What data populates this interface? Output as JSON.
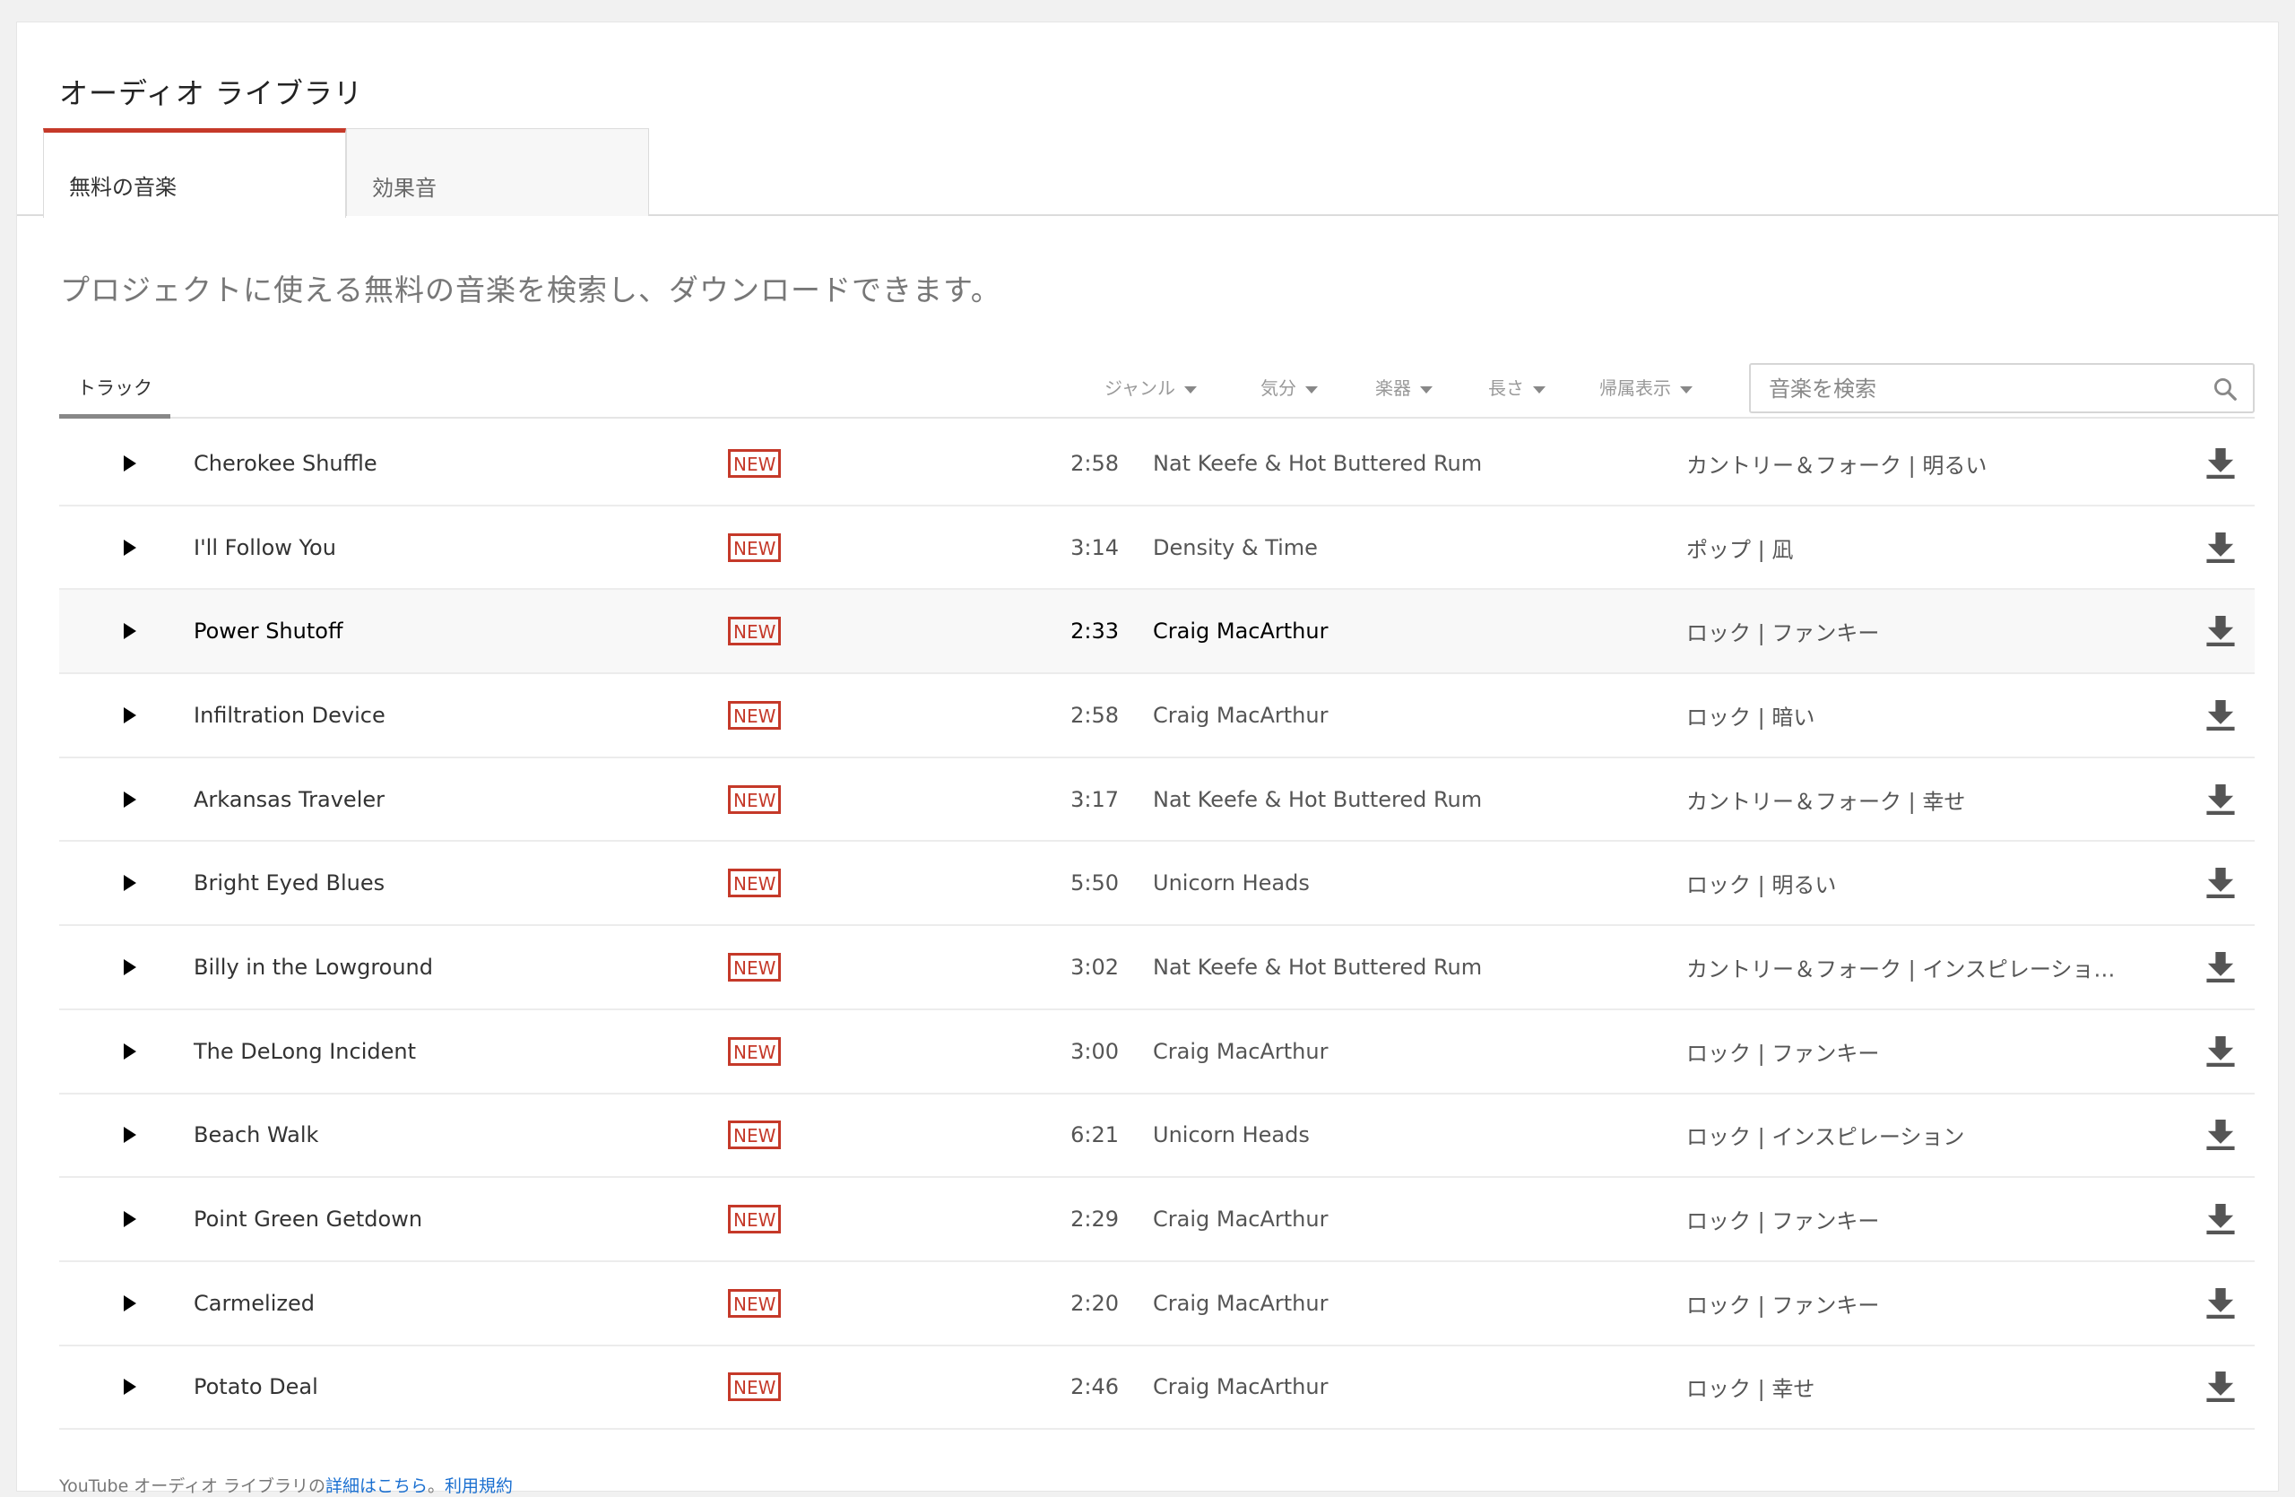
{
  "page_title": "オーディオ ライブラリ",
  "tabs": [
    {
      "label": "無料の音楽",
      "active": true
    },
    {
      "label": "効果音",
      "active": false
    }
  ],
  "subtitle": "プロジェクトに使える無料の音楽を検索し、ダウンロードできます。",
  "filterbar": {
    "tracks_tab": "トラック",
    "filters": [
      "ジャンル",
      "気分",
      "楽器",
      "長さ",
      "帰属表示"
    ],
    "search_placeholder": "音楽を検索"
  },
  "badge_label": "NEW",
  "tracks": [
    {
      "title": "Cherokee Shuffle",
      "duration": "2:58",
      "artist": "Nat Keefe & Hot Buttered Rum",
      "genre": "カントリー＆フォーク | 明るい"
    },
    {
      "title": "I'll Follow You",
      "duration": "3:14",
      "artist": "Density & Time",
      "genre": "ポップ | 凪"
    },
    {
      "title": "Power Shutoff",
      "duration": "2:33",
      "artist": "Craig MacArthur",
      "genre": "ロック | ファンキー"
    },
    {
      "title": "Infiltration Device",
      "duration": "2:58",
      "artist": "Craig MacArthur",
      "genre": "ロック | 暗い"
    },
    {
      "title": "Arkansas Traveler",
      "duration": "3:17",
      "artist": "Nat Keefe & Hot Buttered Rum",
      "genre": "カントリー＆フォーク | 幸せ"
    },
    {
      "title": "Bright Eyed Blues",
      "duration": "5:50",
      "artist": "Unicorn Heads",
      "genre": "ロック | 明るい"
    },
    {
      "title": "Billy in the Lowground",
      "duration": "3:02",
      "artist": "Nat Keefe & Hot Buttered Rum",
      "genre": "カントリー＆フォーク | インスピレーショ…"
    },
    {
      "title": "The DeLong Incident",
      "duration": "3:00",
      "artist": "Craig MacArthur",
      "genre": "ロック | ファンキー"
    },
    {
      "title": "Beach Walk",
      "duration": "6:21",
      "artist": "Unicorn Heads",
      "genre": "ロック | インスピレーション"
    },
    {
      "title": "Point Green Getdown",
      "duration": "2:29",
      "artist": "Craig MacArthur",
      "genre": "ロック | ファンキー"
    },
    {
      "title": "Carmelized",
      "duration": "2:20",
      "artist": "Craig MacArthur",
      "genre": "ロック | ファンキー"
    },
    {
      "title": "Potato Deal",
      "duration": "2:46",
      "artist": "Craig MacArthur",
      "genre": "ロック | 幸せ"
    }
  ],
  "footer": {
    "prefix": "YouTube オーディオ ライブラリの",
    "link1": "詳細はこちら",
    "sep": "。",
    "link2": "利用規約"
  },
  "colors": {
    "accent": "#c53929",
    "link": "#1a6fd0"
  },
  "icons": {
    "play": "play-icon",
    "download": "download-icon",
    "search": "search-icon",
    "filter_caret": "caret-down-icon"
  }
}
